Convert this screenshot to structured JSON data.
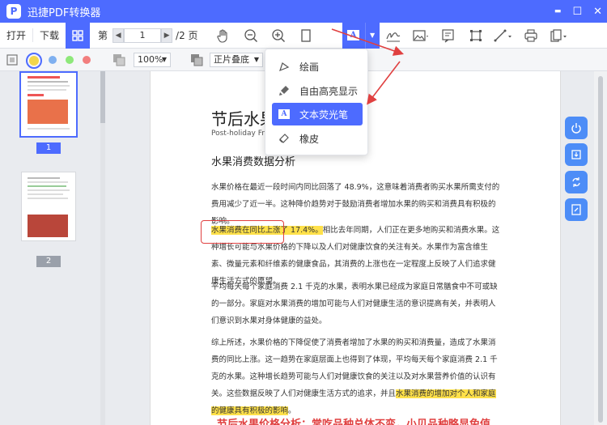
{
  "app": {
    "title": "迅捷PDF转换器",
    "logo": "P"
  },
  "window": {
    "minimize": "▬",
    "maximize": "☐",
    "close": "✕"
  },
  "toolbar": {
    "open_label": "打开",
    "download_label": "下载",
    "page_prefix": "第",
    "current_page": "1",
    "total_pages": "/2 页",
    "text_tool_glyph": "A"
  },
  "subbar": {
    "zoom": "100%",
    "page_mode": "正片叠底",
    "color_dots": [
      "#f2d64b",
      "#7fb0f0",
      "#8ee87a",
      "#f27e7e"
    ]
  },
  "thumbnails": [
    {
      "label": "1"
    },
    {
      "label": "2"
    }
  ],
  "menu": {
    "items": [
      {
        "label": "绘画",
        "icon": "draw-icon"
      },
      {
        "label": "自由高亮显示",
        "icon": "free-highlight-icon"
      },
      {
        "label": "文本荧光笔",
        "icon": "text-highlighter-icon"
      },
      {
        "label": "橡皮",
        "icon": "eraser-icon"
      }
    ]
  },
  "document": {
    "title": "节后水果",
    "subtitle": "Post-holiday Frui",
    "heading": "水果消费数据分析",
    "p1": "水果价格在最近一段时间内同比回落了 48.9%，这意味着消费者购买水果所需支付的费用减少了近一半。这种降价趋势对于鼓励消费者增加水果的购买和消费具有积极的影响。",
    "p2_highlight": "水果消费在同比上涨了 17.4%。",
    "p2_rest": "相比去年同期，人们正在更多地购买和消费水果。这种增长可能与水果价格的下降以及人们对健康饮食的关注有关。水果作为富含维生素、微量元素和纤维素的健康食品，其消费的上涨也在一定程度上反映了人们追求健康生活方式的愿望。",
    "p3": "平均每天每个家庭消费 2.1 千克的水果，表明水果已经成为家庭日常膳食中不可或缺的一部分。家庭对水果消费的增加可能与人们对健康生活的意识提高有关，并表明人们意识到水果对身体健康的益处。",
    "p4_start": "综上所述，水果价格的下降促使了消费者增加了水果的购买和消费量，造成了水果消费的同比上涨。这一趋势在家庭层面上也得到了体现，平均每天每个家庭消费 2.1 千克的水果。这种增长趋势可能与人们对健康饮食的关注以及对水果营养价值的认识有关。这些数据反映了人们对健康生活方式的追求，并且",
    "p4_highlight": "水果消费的增加对个人和家庭的健康具有积极的影响",
    "p4_end": "。",
    "bottom_heading": "节后水果价格分析：常吃品种总体不变，小贝品种略显免值"
  },
  "colors": {
    "accent": "#4d6bff",
    "highlight": "#ffe14a",
    "annotation": "#e04040"
  }
}
